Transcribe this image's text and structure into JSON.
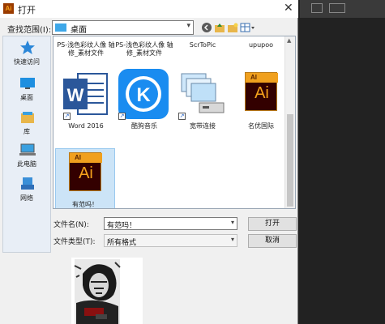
{
  "dialog": {
    "title": "打开",
    "close_glyph": "✕"
  },
  "lookin": {
    "label": "查找范围(I):",
    "value": "桌面"
  },
  "places": [
    {
      "label": "快速访问"
    },
    {
      "label": "桌面"
    },
    {
      "label": "库"
    },
    {
      "label": "此电脑"
    },
    {
      "label": "网络"
    }
  ],
  "files": {
    "partial_row": [
      {
        "label": "PS-浅色彩纹人像 轴修_素材文件"
      },
      {
        "label": "PS-浅色彩纹人像 轴修_素材文件"
      },
      {
        "label": "ScrToPic"
      },
      {
        "label": "upupoo"
      }
    ],
    "row1": [
      {
        "label": "Word 2016",
        "icon": "word-icon"
      },
      {
        "label": "酷狗音乐",
        "icon": "kugou-icon"
      },
      {
        "label": "宽带连接",
        "icon": "network-connection-icon"
      },
      {
        "label": "名优国际",
        "icon": "illustrator-file-icon",
        "ai_text": "Ai",
        "ai_mini": "AI"
      }
    ],
    "row2": [
      {
        "label": "有范吗！",
        "icon": "illustrator-file-icon",
        "ai_text": "Ai",
        "ai_mini": "AI"
      }
    ]
  },
  "filename": {
    "label": "文件名(N):",
    "value": "有范吗！"
  },
  "filetype": {
    "label": "文件类型(T):",
    "value": "所有格式"
  },
  "buttons": {
    "open": "打开",
    "cancel": "取消"
  },
  "colors": {
    "ai_orange": "#f7a21c",
    "ai_dark": "#330000",
    "word_blue": "#2b579a",
    "kugou_blue": "#1a8cf0",
    "folder_blue": "#3ea7e8"
  }
}
